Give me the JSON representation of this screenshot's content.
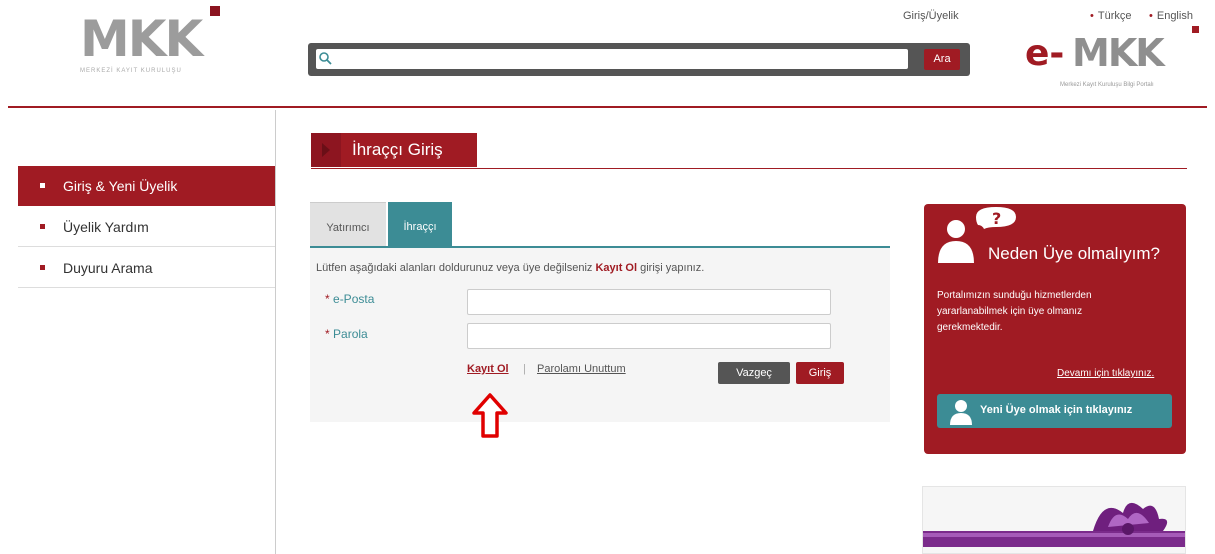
{
  "header": {
    "logo_text": "MKK",
    "logo_subtitle": "MERKEZİ KAYIT KURULUŞU",
    "search": {
      "placeholder": "",
      "button_label": "Ara"
    },
    "login_link": "Giriş/Üyelik",
    "languages": [
      "Türkçe",
      "English"
    ],
    "eportal_logo_prefix": "e-",
    "eportal_logo_text": "MKK",
    "eportal_subtitle": "Merkezi Kayıt Kuruluşu Bilgi Portalı"
  },
  "sidebar": {
    "items": [
      {
        "label": "Giriş & Yeni Üyelik",
        "active": true
      },
      {
        "label": "Üyelik Yardım",
        "active": false
      },
      {
        "label": "Duyuru Arama",
        "active": false
      }
    ]
  },
  "main": {
    "title": "İhraççı Giriş",
    "tabs": [
      {
        "label": "Yatırımcı",
        "active": false
      },
      {
        "label": "İhraççı",
        "active": true
      }
    ],
    "info_prefix": "Lütfen aşağıdaki alanları doldurunuz veya üye değilseniz ",
    "info_bold": "Kayıt Ol",
    "info_suffix": " girişi yapınız.",
    "fields": [
      {
        "label": "e-Posta",
        "value": ""
      },
      {
        "label": "Parola",
        "value": ""
      }
    ],
    "required_mark": "*",
    "register_link": "Kayıt Ol",
    "separator": "|",
    "forgot_link": "Parolamı Unuttum",
    "cancel_button": "Vazgeç",
    "login_button": "Giriş"
  },
  "why_box": {
    "title": "Neden Üye olmalıyım?",
    "text": "Portalımızın sunduğu hizmetlerden yararlanabilmek için üye olmanız gerekmektedir.",
    "more_link": "Devamı için tıklayınız.",
    "cta_button": "Yeni Üye olmak için tıklayınız"
  },
  "colors": {
    "brand": "#a01b23",
    "accent": "#3c8c95",
    "annotation": "#e00000"
  }
}
